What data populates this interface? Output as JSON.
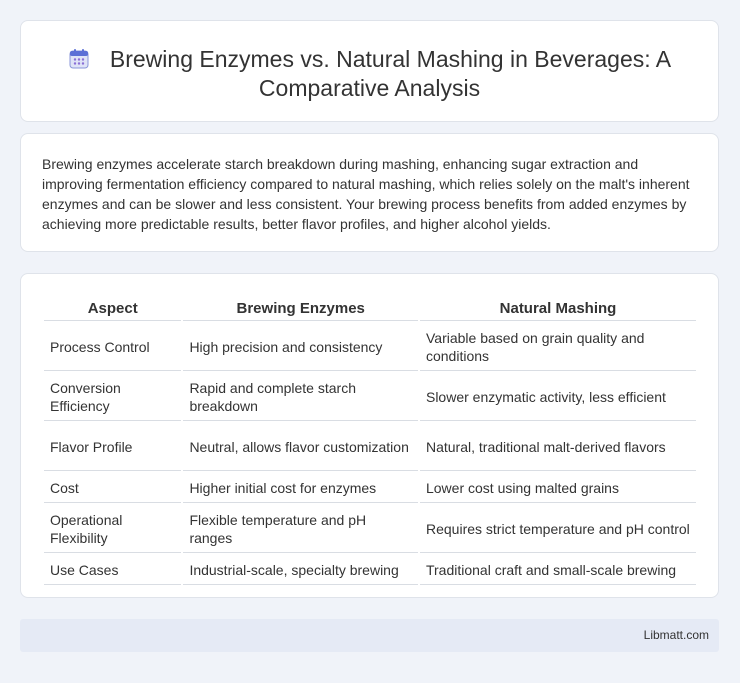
{
  "header": {
    "title_line1": "Brewing Enzymes vs. Natural Mashing in Beverages: A",
    "title_line2": "Comparative Analysis",
    "icon": "calendar-icon"
  },
  "intro": "Brewing enzymes accelerate starch breakdown during mashing, enhancing sugar extraction and improving fermentation efficiency compared to natural mashing, which relies solely on the malt's inherent enzymes and can be slower and less consistent. Your brewing process benefits from added enzymes by achieving more predictable results, better flavor profiles, and higher alcohol yields.",
  "table": {
    "headers": [
      "Aspect",
      "Brewing Enzymes",
      "Natural Mashing"
    ],
    "rows": [
      [
        "Process Control",
        "High precision and consistency",
        "Variable based on grain quality and conditions"
      ],
      [
        "Conversion Efficiency",
        "Rapid and complete starch breakdown",
        "Slower enzymatic activity, less efficient"
      ],
      [
        "Flavor Profile",
        "Neutral, allows flavor customization",
        "Natural, traditional malt-derived flavors"
      ],
      [
        "Cost",
        "Higher initial cost for enzymes",
        "Lower cost using malted grains"
      ],
      [
        "Operational Flexibility",
        "Flexible temperature and pH ranges",
        "Requires strict temperature and pH control"
      ],
      [
        "Use Cases",
        "Industrial-scale, specialty brewing",
        "Traditional craft and small-scale brewing"
      ]
    ]
  },
  "footer": {
    "brand": "Libmatt.com"
  }
}
